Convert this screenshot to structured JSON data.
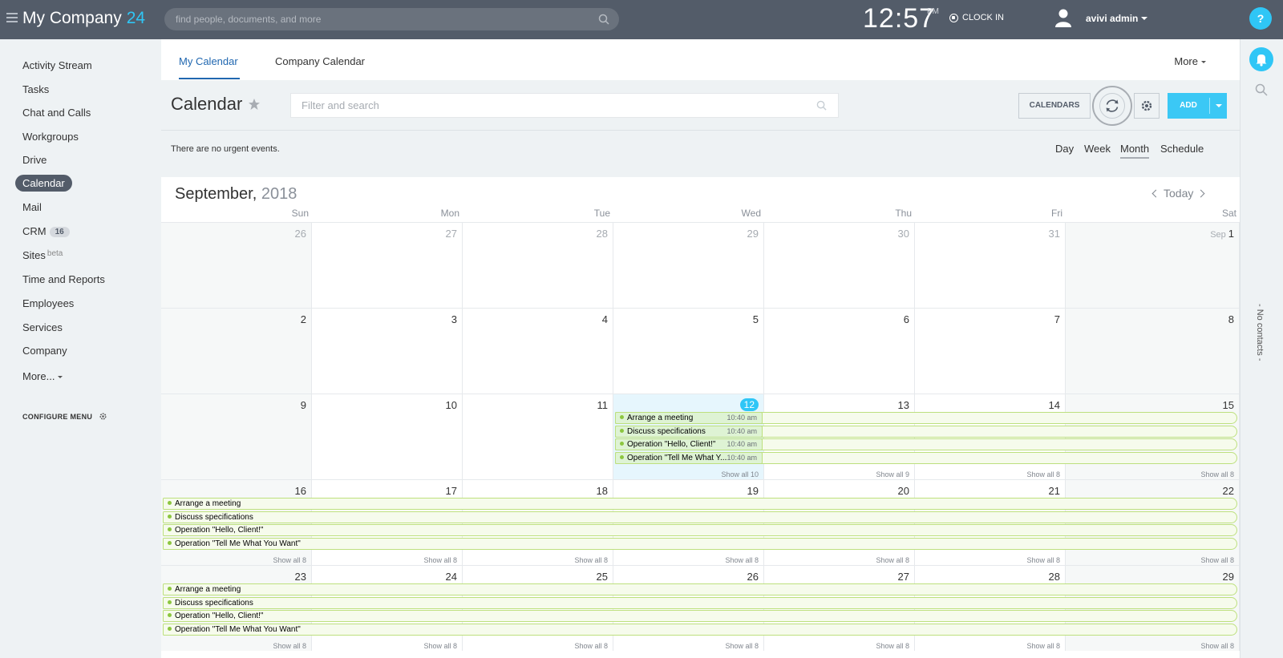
{
  "topbar": {
    "logo_text": "My Company",
    "logo_num": "24",
    "search_placeholder": "find people, documents, and more",
    "time": "12:57",
    "ampm": "PM",
    "clockin": "CLOCK IN",
    "user_name": "avivi admin",
    "help": "?"
  },
  "sidebar": {
    "items": [
      {
        "label": "Activity Stream"
      },
      {
        "label": "Tasks"
      },
      {
        "label": "Chat and Calls"
      },
      {
        "label": "Workgroups"
      },
      {
        "label": "Drive"
      },
      {
        "label": "Calendar",
        "active": true
      },
      {
        "label": "Mail"
      },
      {
        "label": "CRM",
        "badge": "16"
      },
      {
        "label": "Sites",
        "sup": "beta"
      },
      {
        "label": "Time and Reports"
      },
      {
        "label": "Employees"
      },
      {
        "label": "Services"
      },
      {
        "label": "Company"
      },
      {
        "label": "More..."
      }
    ],
    "configure": "CONFIGURE MENU"
  },
  "right_rail": {
    "no_contacts": "- No contacts -"
  },
  "tabs": {
    "my_calendar": "My Calendar",
    "company_calendar": "Company Calendar",
    "more": "More"
  },
  "toolbar": {
    "title": "Calendar",
    "filter_placeholder": "Filter and search",
    "calendars": "CALENDARS",
    "add": "ADD"
  },
  "info": {
    "urgent": "There are no urgent events.",
    "views": [
      "Day",
      "Week",
      "Month",
      "Schedule"
    ],
    "active_view": "Month"
  },
  "calendar": {
    "month": "September,",
    "year": "2018",
    "today": "Today",
    "weekdays": [
      "Sun",
      "Mon",
      "Tue",
      "Wed",
      "Thu",
      "Fri",
      "Sat"
    ],
    "weeks": [
      [
        {
          "d": "26",
          "other": true
        },
        {
          "d": "27",
          "other": true
        },
        {
          "d": "28",
          "other": true
        },
        {
          "d": "29",
          "other": true
        },
        {
          "d": "30",
          "other": true
        },
        {
          "d": "31",
          "other": true
        },
        {
          "d": "1",
          "month": "Sep"
        }
      ],
      [
        {
          "d": "2"
        },
        {
          "d": "3"
        },
        {
          "d": "4"
        },
        {
          "d": "5"
        },
        {
          "d": "6"
        },
        {
          "d": "7"
        },
        {
          "d": "8"
        }
      ],
      [
        {
          "d": "9"
        },
        {
          "d": "10"
        },
        {
          "d": "11"
        },
        {
          "d": "12",
          "today": true,
          "show": "Show all 10"
        },
        {
          "d": "13",
          "show": "Show all 9"
        },
        {
          "d": "14",
          "show": "Show all 8"
        },
        {
          "d": "15",
          "show": "Show all 8"
        }
      ],
      [
        {
          "d": "16",
          "show": "Show all 8"
        },
        {
          "d": "17",
          "show": "Show all 8"
        },
        {
          "d": "18",
          "show": "Show all 8"
        },
        {
          "d": "19",
          "show": "Show all 8"
        },
        {
          "d": "20",
          "show": "Show all 8"
        },
        {
          "d": "21",
          "show": "Show all 8"
        },
        {
          "d": "22",
          "show": "Show all 8"
        }
      ],
      [
        {
          "d": "23",
          "show": "Show all 8"
        },
        {
          "d": "24",
          "show": "Show all 8"
        },
        {
          "d": "25",
          "show": "Show all 8"
        },
        {
          "d": "26",
          "show": "Show all 8"
        },
        {
          "d": "27",
          "show": "Show all 8"
        },
        {
          "d": "28",
          "show": "Show all 8"
        },
        {
          "d": "29",
          "show": "Show all 8"
        }
      ]
    ],
    "week3_events": [
      {
        "title": "Arrange a meeting",
        "time": "10:40 am"
      },
      {
        "title": "Discuss specifications",
        "time": "10:40 am"
      },
      {
        "title": "Operation \"Hello, Client!\"",
        "time": "10:40 am"
      },
      {
        "title": "Operation \"Tell Me What Y...",
        "time": "10:40 am"
      }
    ],
    "week_events": [
      {
        "title": "Arrange a meeting"
      },
      {
        "title": "Discuss specifications"
      },
      {
        "title": "Operation \"Hello, Client!\""
      },
      {
        "title": "Operation \"Tell Me What You Want\""
      }
    ]
  },
  "colors": {
    "accent": "#2fc6f6",
    "header": "#535c69",
    "event_border": "#bde07e",
    "event_dot": "#8cc63f"
  }
}
